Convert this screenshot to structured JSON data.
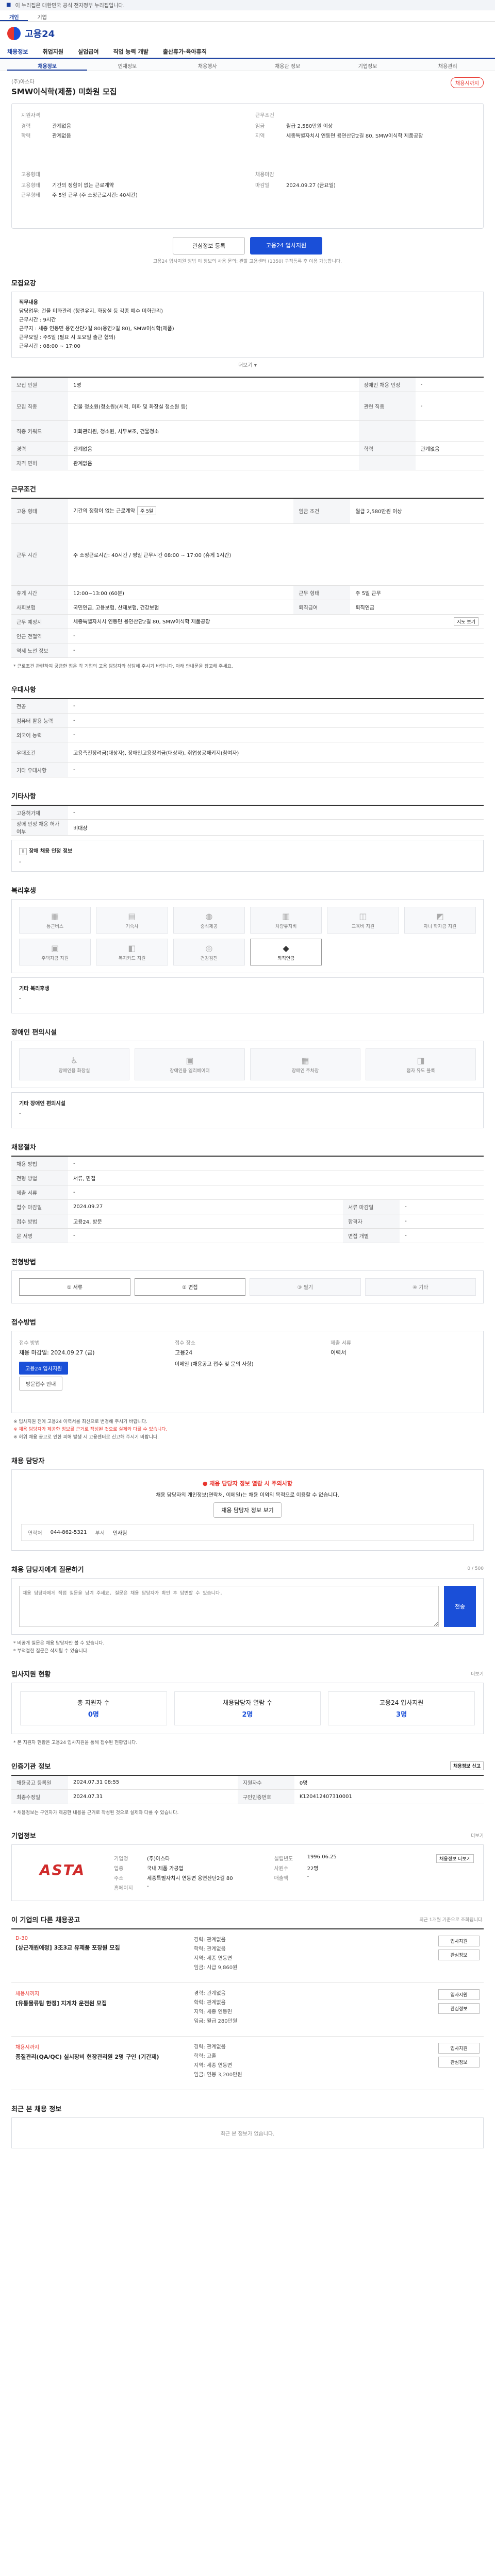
{
  "gov_bar": {
    "flag": "■",
    "text": "이 누리집은 대한민국 공식 전자정부 누리집입니다."
  },
  "site_tabs": [
    "개인",
    "기업"
  ],
  "logo": {
    "text": "고용24"
  },
  "gnb": [
    "채용정보",
    "취업지원",
    "실업급여",
    "직업 능력 개발",
    "출산휴가·육아휴직"
  ],
  "lnb": [
    "채용정보",
    "인재정보",
    "채용행사",
    "채용관 정보",
    "기업정보",
    "채용관리"
  ],
  "job": {
    "company": "(주)아스타",
    "title": "SMW이식학(제품) 미화원 모집",
    "status": "채용시까지"
  },
  "summary": {
    "left_title": "지원자격",
    "left_rows": [
      {
        "k": "경력",
        "v": "관계없음"
      },
      {
        "k": "학력",
        "v": "관계없음"
      }
    ],
    "right_title": "근무조건",
    "right_rows": [
      {
        "k": "임금",
        "v": "월급 2,580만원 이상"
      },
      {
        "k": "지역",
        "v": "세종특별자치시 연동면 용연산단2길 80, SMW이식학 제품공장"
      }
    ],
    "bottom_left_title": "고용형태",
    "bottom_left_rows": [
      {
        "k": "고용형태",
        "v": "기간의 정함이 없는 근로계약"
      },
      {
        "k": "근무형태",
        "v": "주 5일 근무 (주 소정근로시간: 40시간)"
      }
    ],
    "bottom_right_title": "채용마감",
    "bottom_right_rows": [
      {
        "k": "마감일",
        "v": "2024.09.27 (금요일)"
      }
    ]
  },
  "actions": {
    "save": "관심정보 등록",
    "apply": "고용24 입사지원",
    "note": "고용24 입사지원 방법 이 정보의 사용 문의: 관할 고용센터 (1350) 구직등록 후 이용 가능합니다."
  },
  "sections": {
    "recruit": "모집요강",
    "recruit_box": {
      "head": "직무내용",
      "lines": [
        "담당업무: 건물 미화관리 (청결유지, 화장실 등 각종 폐수 미화관리)",
        "근무시간 : 9시간",
        "근무지 : 세종 연동면 용연산단2길 80(용연2길 80), SMW이식학(제품)",
        "근무요일 : 주5일 (필요 시 토요일 출근 협의)",
        "근무시간 : 08:00 ~ 17:00"
      ],
      "more": "더보기"
    },
    "recruit_table": [
      {
        "k": "모집 인원",
        "v": "1명",
        "k2": "장애인 채용 인정",
        "v2": "-"
      },
      {
        "k": "모집 직종",
        "v": "건물 청소원(청소원)(세척, 미화 및 화장실 청소원 등)",
        "k2": "관련 직종",
        "v2": "-"
      },
      {
        "k": "직종 키워드",
        "v": "미화관리원, 청소원, 사무보조, 건물청소",
        "k2": "",
        "v2": ""
      },
      {
        "k": "경력",
        "v": "관계없음",
        "k2": "학력",
        "v2": "관계없음"
      },
      {
        "k": "자격 면허",
        "v": "관계없음",
        "k2": "",
        "v2": ""
      }
    ],
    "work": "근무조건",
    "work_table": [
      {
        "k": "고용 형태",
        "v": "기간의 정함이 없는 근로계약",
        "tag": "주 5일",
        "k2": "임금 조건",
        "v2": "월급 2,580만원 이상"
      },
      {
        "k": "근무 시간",
        "v": "주 소정근로시간: 40시간 / 평일 근무시간 08:00 ~ 17:00 (휴게 1시간)",
        "tag": "",
        "k2": "",
        "v2": ""
      },
      {
        "k": "휴게 시간",
        "v": "12:00~13:00 (60분)",
        "tag": "",
        "k2": "근무 형태",
        "v2": "주 5일 근무"
      },
      {
        "k": "사회보험",
        "v": "국민연금, 고용보험, 산재보험, 건강보험",
        "tag": "",
        "k2": "퇴직급여",
        "v2": "퇴직연금"
      },
      {
        "k": "근무 예정지",
        "v": "세종특별자치시 연동면 용연산단2길 80, SMW이식학 제품공장",
        "tag": "지도 보기",
        "k2": "",
        "v2": ""
      },
      {
        "k": "인근 전철역",
        "v": "-",
        "tag": "",
        "k2": "",
        "v2": ""
      },
      {
        "k": "역세 노선 정보",
        "v": "-",
        "tag": "",
        "k2": "",
        "v2": ""
      }
    ],
    "work_note": "* 근로조건 관련하여 궁금한 점은 각 기업의 고용 담당자와 상담해 주시기 바랍니다. 아래 안내문을 참고해 주세요.",
    "welfare": "우대사항",
    "welfare_table": [
      {
        "k": "전공",
        "v": "-"
      },
      {
        "k": "컴퓨터 활용 능력",
        "v": "-"
      },
      {
        "k": "외국어 능력",
        "v": "-"
      },
      {
        "k": "우대조건",
        "v": "고용촉진장려금(대상자), 장애인고용장려금(대상자), 취업성공패키지(참여자)"
      },
      {
        "k": "기타 우대사항",
        "v": "-"
      }
    ],
    "etc": "기타사항",
    "etc_table": [
      {
        "k": "고용허가제",
        "v": "-"
      },
      {
        "k": "장애 인정 채용 허가 여부",
        "v": "비대상"
      }
    ],
    "etc_btn": "장애 채용 인정 정보",
    "etc_btn_text": "-",
    "benefits": "복리후생",
    "benefits_icons": [
      {
        "icon": "▦",
        "label": "통근버스",
        "on": false
      },
      {
        "icon": "▤",
        "label": "기숙사",
        "on": false
      },
      {
        "icon": "◍",
        "label": "중식제공",
        "on": false
      },
      {
        "icon": "▥",
        "label": "차량유지비",
        "on": false
      },
      {
        "icon": "◫",
        "label": "교육비 지원",
        "on": false
      },
      {
        "icon": "◩",
        "label": "자녀 학자금 지원",
        "on": false
      },
      {
        "icon": "▣",
        "label": "주택자금 지원",
        "on": false
      },
      {
        "icon": "◧",
        "label": "복지카드 지원",
        "on": false
      },
      {
        "icon": "◎",
        "label": "건강검진",
        "on": false
      },
      {
        "icon": "◆",
        "label": "퇴직연금",
        "on": true
      }
    ],
    "benefits_etc_title": "기타 복리후생",
    "benefits_etc_text": "-",
    "disabled_facility": "장애인 편의시설",
    "facility_icons": [
      {
        "icon": "♿",
        "label": "장애인용 화장실",
        "on": false
      },
      {
        "icon": "▣",
        "label": "장애인용 엘리베이터",
        "on": false
      },
      {
        "icon": "▦",
        "label": "장애인 주차장",
        "on": false
      },
      {
        "icon": "◨",
        "label": "점자 유도 블록",
        "on": false
      }
    ],
    "facility_etc_title": "기타 장애인 편의시설",
    "facility_etc_text": "-",
    "process": "채용절차",
    "process_table": [
      {
        "k": "채용 방법",
        "v": "-",
        "k2": "",
        "v2": ""
      },
      {
        "k": "전형 방법",
        "v": "서류, 면접",
        "k2": "",
        "v2": ""
      },
      {
        "k": "제출 서류",
        "v": "-",
        "k2": "",
        "v2": ""
      },
      {
        "k": "접수 마감일",
        "v": "2024.09.27",
        "k2": "서류 마감일",
        "v2": "-"
      },
      {
        "k": "접수 방법",
        "v": "고용24, 방문",
        "k2": "합격자",
        "v2": "-"
      },
      {
        "k": "문 서명",
        "v": "-",
        "k2": "면접 개별",
        "v2": "-"
      }
    ],
    "steps_title": "전형방법",
    "steps": [
      {
        "label": "① 서류",
        "on": true
      },
      {
        "label": "② 면접",
        "on": true
      },
      {
        "label": "③ 필기",
        "on": false
      },
      {
        "label": "④ 기타",
        "on": false
      }
    ],
    "apply_title": "접수방법",
    "apply_box": {
      "col1_title": "접수 방법",
      "col1_main": "채용 마감일: 2024.09.27 (금)",
      "col1_btn1": "고용24 입사지원",
      "col1_btn2": "방문접수 안내",
      "col2_title": "접수 장소",
      "col2_main": "고용24",
      "col2_sub": "이메일 (채용공고 접수 및 문의 사항)",
      "col3_title": "제출 서류",
      "col3_main": "이력서"
    },
    "apply_notes": [
      "※ 입사지원 전에 고용24 이력서를 최신으로 변경해 주시기 바랍니다.",
      "※ 채용 담당자가 제공한 정보를 근거로 작성된 것으로 실제와 다를 수 있습니다.",
      "※ 허위 채용 공고로 인한 피해 발생 시 고용센터로 신고해 주시기 바랍니다."
    ],
    "contact": "채용 담당자",
    "contact_warn": "채용 담당자 정보 열람 시 주의사항",
    "contact_desc": "채용 담당자의 개인정보(연락처, 이메일)는 채용 이외의 목적으로 이용할 수 없습니다.",
    "contact_btn": "채용 담당자 정보 보기",
    "contact_phone_label": "연락처",
    "contact_phone": "044-862-5321",
    "contact_dept_label": "부서",
    "contact_dept": "인사팀",
    "question": "채용 담당자에게 질문하기",
    "question_placeholder": "채용 담당자에게 직접 질문을 남겨 주세요. 질문은 채용 담당자가 확인 후 답변할 수 있습니다.",
    "question_send": "전송",
    "question_count": "0 / 500",
    "question_notes": [
      "* 비공개 질문은 채용 담당자만 볼 수 있습니다.",
      "* 부적절한 질문은 삭제될 수 있습니다."
    ],
    "applicants": "입사지원 현황",
    "applicants_more": "더보기",
    "stats": [
      {
        "label": "총 지원자 수",
        "value": "0명"
      },
      {
        "label": "채용담당자 열람 수",
        "value": "2명"
      },
      {
        "label": "고용24 입사지원",
        "value": "3명"
      }
    ],
    "applicants_note": "* 본 지원자 현황은 고용24 입사지원을 통해 접수된 현황입니다.",
    "register": "인증기관 정보",
    "register_btn": "채용정보 신고",
    "register_table": [
      {
        "k": "채용공고 등록일",
        "v": "2024.07.31 08:55",
        "k2": "지원자수",
        "v2": "0명"
      },
      {
        "k": "최종수정일",
        "v": "2024.07.31",
        "k2": "구인인증번호",
        "v2": "K120412407310001"
      }
    ],
    "register_note": "* 채용정보는 구인자가 제공한 내용을 근거로 작성된 것으로 실제와 다를 수 있습니다.",
    "company": "기업정보",
    "company_more": "더보기",
    "company_logo_a": "ASTA",
    "company_info": [
      {
        "k": "기업명",
        "v": "(주)아스타"
      },
      {
        "k": "설립년도",
        "v": "1996.06.25"
      },
      {
        "k": "업종",
        "v": "국내 제품 가공업"
      },
      {
        "k": "사원수",
        "v": "22명"
      },
      {
        "k": "주소",
        "v": "세종특별자치시 연동면 용연산단2길 80"
      },
      {
        "k": "매출액",
        "v": "-"
      },
      {
        "k": "홈페이지",
        "v": "-"
      }
    ],
    "company_btn": "채용정보 더보기",
    "others": "이 기업의 다른 채용공고",
    "others_note": "최근 1개월 기준으로 조회됩니다.",
    "other_items": [
      {
        "tag": "D-30",
        "title": "[상근개원예정] 3조3교 유제품 포장원 모집",
        "lines": [
          "경력: 관계없음",
          "학력: 관계없음",
          "지역: 세종 연동면",
          "임금: 시급 9,860원"
        ],
        "btns": [
          "입사지원",
          "관심정보"
        ]
      },
      {
        "tag": "채용시까지",
        "title": "[유통물류팀 한정] 지게차 운전원 모집",
        "lines": [
          "경력: 관계없음",
          "학력: 관계없음",
          "지역: 세종 연동면",
          "임금: 월급 280만원"
        ],
        "btns": [
          "입사지원",
          "관심정보"
        ]
      },
      {
        "tag": "채용시까지",
        "title": "품질관리(QA/QC) 실시장비 현장관리원 2명 구인 (기간제)",
        "lines": [
          "경력: 관계없음",
          "학력: 고졸",
          "지역: 세종 연동면",
          "임금: 연봉 3,200만원"
        ],
        "btns": [
          "입사지원",
          "관심정보"
        ]
      }
    ],
    "recent": "최근 본 채용 정보",
    "recent_empty": "최근 본 정보가 없습니다."
  }
}
